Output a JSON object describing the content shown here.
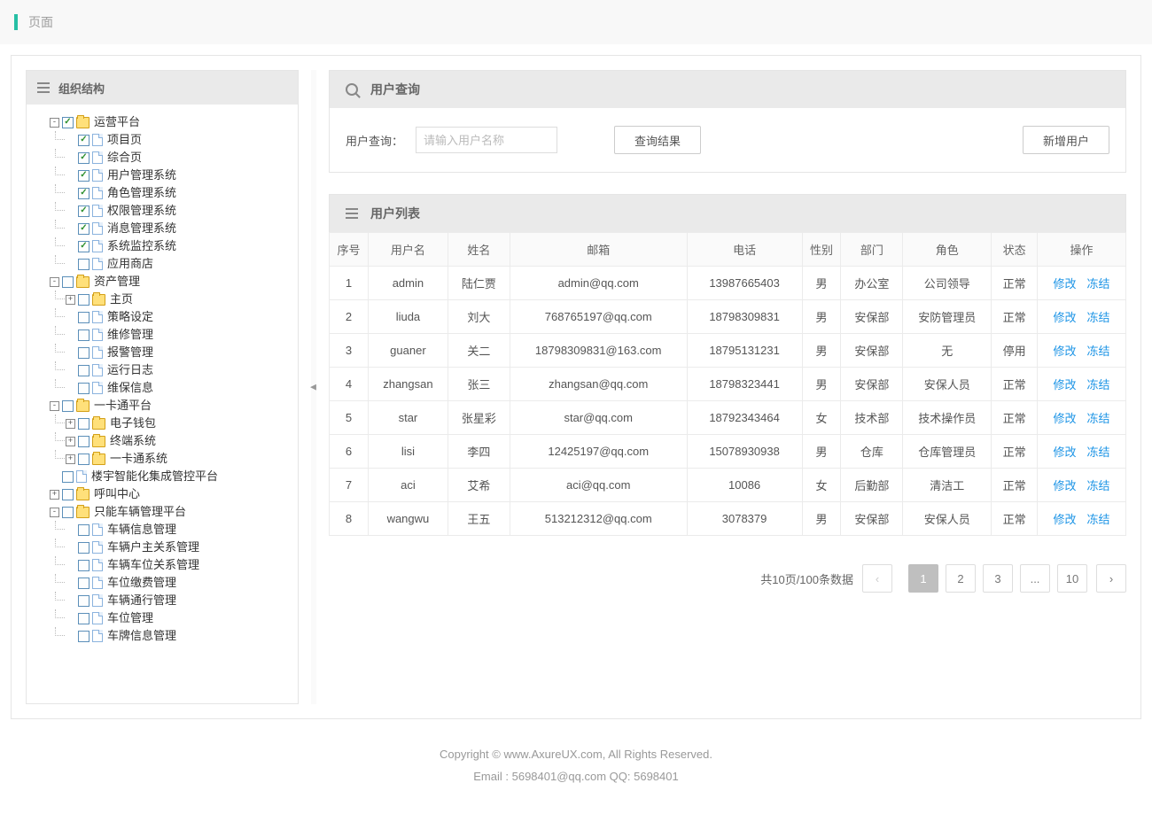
{
  "top": {
    "title": "页面"
  },
  "sidebar": {
    "title": "组织结构",
    "tree": [
      {
        "t": "-",
        "c": true,
        "ico": "folder",
        "label": "运营平台",
        "children": [
          {
            "t": "",
            "c": true,
            "ico": "page",
            "label": "项目页"
          },
          {
            "t": "",
            "c": true,
            "ico": "page",
            "label": "综合页"
          },
          {
            "t": "",
            "c": true,
            "ico": "page",
            "label": "用户管理系统"
          },
          {
            "t": "",
            "c": true,
            "ico": "page",
            "label": "角色管理系统"
          },
          {
            "t": "",
            "c": true,
            "ico": "page",
            "label": "权限管理系统"
          },
          {
            "t": "",
            "c": true,
            "ico": "page",
            "label": "消息管理系统"
          },
          {
            "t": "",
            "c": true,
            "ico": "page",
            "label": "系统监控系统"
          },
          {
            "t": "",
            "c": false,
            "ico": "page",
            "label": "应用商店"
          }
        ]
      },
      {
        "t": "-",
        "c": false,
        "ico": "folder",
        "label": "资产管理",
        "children": [
          {
            "t": "+",
            "c": false,
            "ico": "folder",
            "label": "主页"
          },
          {
            "t": "",
            "c": false,
            "ico": "page",
            "label": "策略设定"
          },
          {
            "t": "",
            "c": false,
            "ico": "page",
            "label": "维修管理"
          },
          {
            "t": "",
            "c": false,
            "ico": "page",
            "label": "报警管理"
          },
          {
            "t": "",
            "c": false,
            "ico": "page",
            "label": "运行日志"
          },
          {
            "t": "",
            "c": false,
            "ico": "page",
            "label": "维保信息"
          }
        ]
      },
      {
        "t": "-",
        "c": false,
        "ico": "folder",
        "label": "一卡通平台",
        "children": [
          {
            "t": "+",
            "c": false,
            "ico": "folder",
            "label": "电子钱包"
          },
          {
            "t": "+",
            "c": false,
            "ico": "folder",
            "label": "终端系统"
          },
          {
            "t": "+",
            "c": false,
            "ico": "folder",
            "label": "一卡通系统"
          }
        ]
      },
      {
        "t": "",
        "c": false,
        "ico": "page",
        "label": "楼宇智能化集成管控平台"
      },
      {
        "t": "+",
        "c": false,
        "ico": "folder",
        "label": "呼叫中心"
      },
      {
        "t": "-",
        "c": false,
        "ico": "folder",
        "label": "只能车辆管理平台",
        "children": [
          {
            "t": "",
            "c": false,
            "ico": "page",
            "label": "车辆信息管理"
          },
          {
            "t": "",
            "c": false,
            "ico": "page",
            "label": "车辆户主关系管理"
          },
          {
            "t": "",
            "c": false,
            "ico": "page",
            "label": "车辆车位关系管理"
          },
          {
            "t": "",
            "c": false,
            "ico": "page",
            "label": "车位缴费管理"
          },
          {
            "t": "",
            "c": false,
            "ico": "page",
            "label": "车辆通行管理"
          },
          {
            "t": "",
            "c": false,
            "ico": "page",
            "label": "车位管理"
          },
          {
            "t": "",
            "c": false,
            "ico": "page",
            "label": "车牌信息管理"
          }
        ]
      }
    ]
  },
  "query": {
    "panel_title": "用户查询",
    "label": "用户查询：",
    "placeholder": "请输入用户名称",
    "btn_search": "查询结果",
    "btn_add": "新增用户"
  },
  "list": {
    "panel_title": "用户列表",
    "columns": [
      "序号",
      "用户名",
      "姓名",
      "邮箱",
      "电话",
      "性别",
      "部门",
      "角色",
      "状态",
      "操作"
    ],
    "ops": {
      "edit": "修改",
      "freeze": "冻结"
    },
    "rows": [
      {
        "i": 1,
        "user": "admin",
        "name": "陆仁贾",
        "mail": "admin@qq.com",
        "tel": "13987665403",
        "sex": "男",
        "dept": "办公室",
        "role": "公司领导",
        "stat": "正常"
      },
      {
        "i": 2,
        "user": "liuda",
        "name": "刘大",
        "mail": "768765197@qq.com",
        "tel": "18798309831",
        "sex": "男",
        "dept": "安保部",
        "role": "安防管理员",
        "stat": "正常"
      },
      {
        "i": 3,
        "user": "guaner",
        "name": "关二",
        "mail": "18798309831@163.com",
        "tel": "18795131231",
        "sex": "男",
        "dept": "安保部",
        "role": "无",
        "stat": "停用"
      },
      {
        "i": 4,
        "user": "zhangsan",
        "name": "张三",
        "mail": "zhangsan@qq.com",
        "tel": "18798323441",
        "sex": "男",
        "dept": "安保部",
        "role": "安保人员",
        "stat": "正常"
      },
      {
        "i": 5,
        "user": "star",
        "name": "张星彩",
        "mail": "star@qq.com",
        "tel": "18792343464",
        "sex": "女",
        "dept": "技术部",
        "role": "技术操作员",
        "stat": "正常"
      },
      {
        "i": 6,
        "user": "lisi",
        "name": "李四",
        "mail": "12425197@qq.com",
        "tel": "15078930938",
        "sex": "男",
        "dept": "仓库",
        "role": "仓库管理员",
        "stat": "正常"
      },
      {
        "i": 7,
        "user": "aci",
        "name": "艾希",
        "mail": "aci@qq.com",
        "tel": "10086",
        "sex": "女",
        "dept": "后勤部",
        "role": "清洁工",
        "stat": "正常"
      },
      {
        "i": 8,
        "user": "wangwu",
        "name": "王五",
        "mail": "513212312@qq.com",
        "tel": "3078379",
        "sex": "男",
        "dept": "安保部",
        "role": "安保人员",
        "stat": "正常"
      }
    ]
  },
  "pager": {
    "summary": "共10页/100条数据",
    "prev": "‹",
    "next": "›",
    "pages": [
      "1",
      "2",
      "3",
      "...",
      "10"
    ],
    "active": 0
  },
  "footer": {
    "l1": "Copyright © www.AxureUX.com, All Rights Reserved.",
    "l2": "Email : 5698401@qq.com  QQ: 5698401"
  }
}
